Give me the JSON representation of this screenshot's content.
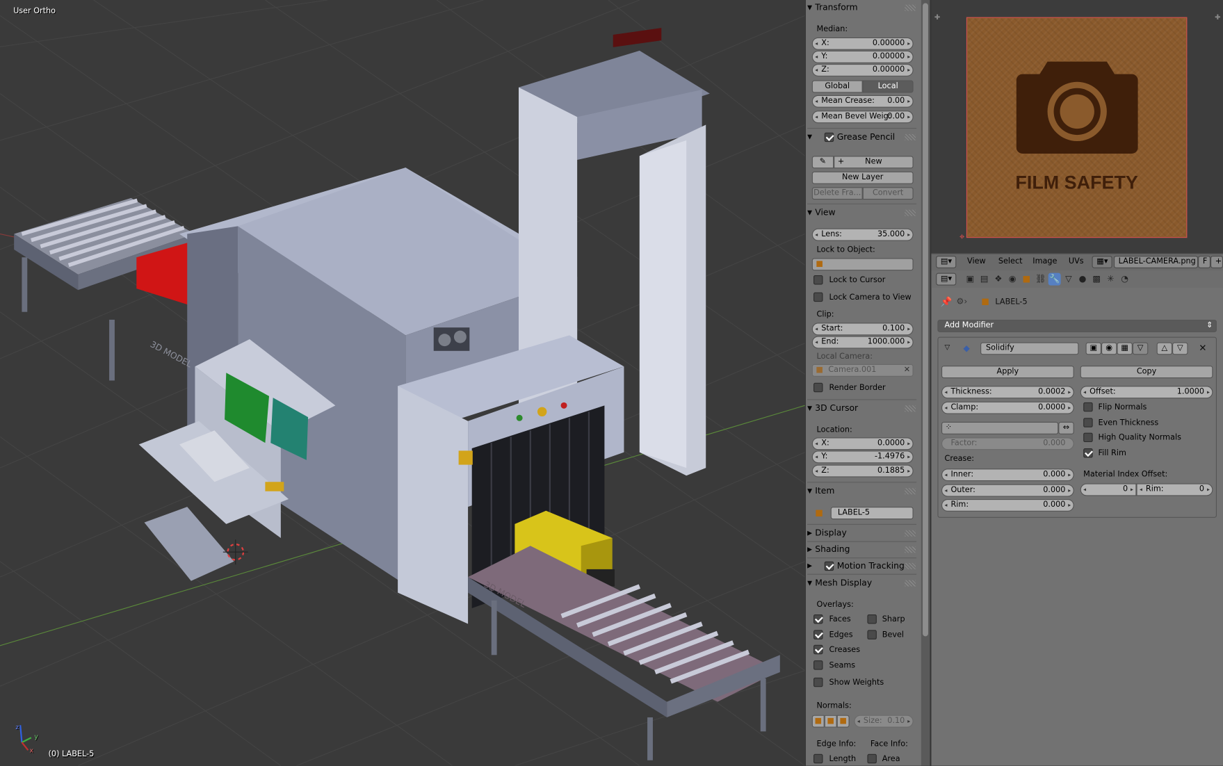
{
  "viewport": {
    "view_name": "User Ortho",
    "object_info": "(0) LABEL-5",
    "watermark": "3D MODEL",
    "axis": {
      "x": "x",
      "y": "y",
      "z": "z"
    }
  },
  "transform": {
    "title": "Transform",
    "median_label": "Median:",
    "x": {
      "label": "X:",
      "value": "0.00000"
    },
    "y": {
      "label": "Y:",
      "value": "0.00000"
    },
    "z": {
      "label": "Z:",
      "value": "0.00000"
    },
    "global_label": "Global",
    "local_label": "Local",
    "mean_crease": {
      "label": "Mean Crease:",
      "value": "0.00"
    },
    "mean_bevel": {
      "label": "Mean Bevel Weig:",
      "value": "0.00"
    }
  },
  "grease_pencil": {
    "title": "Grease Pencil",
    "new_label": "New",
    "new_layer_label": "New Layer",
    "delete_frame_label": "Delete Fra...",
    "convert_label": "Convert"
  },
  "view": {
    "title": "View",
    "lens": {
      "label": "Lens:",
      "value": "35.000"
    },
    "lock_to_object_label": "Lock to Object:",
    "lock_to_cursor_label": "Lock to Cursor",
    "lock_camera_label": "Lock Camera to View",
    "clip_label": "Clip:",
    "clip_start": {
      "label": "Start:",
      "value": "0.100"
    },
    "clip_end": {
      "label": "End:",
      "value": "1000.000"
    },
    "local_camera_label": "Local Camera:",
    "local_camera_value": "Camera.001",
    "render_border_label": "Render Border"
  },
  "cursor": {
    "title": "3D Cursor",
    "location_label": "Location:",
    "x": {
      "label": "X:",
      "value": "0.0000"
    },
    "y": {
      "label": "Y:",
      "value": "-1.4976"
    },
    "z": {
      "label": "Z:",
      "value": "0.1885"
    }
  },
  "item": {
    "title": "Item",
    "name": "LABEL-5"
  },
  "collapsed": {
    "display": "Display",
    "shading": "Shading",
    "motion_tracking": "Motion Tracking"
  },
  "mesh_display": {
    "title": "Mesh Display",
    "overlays_label": "Overlays:",
    "faces": "Faces",
    "sharp": "Sharp",
    "edges": "Edges",
    "bevel": "Bevel",
    "creases": "Creases",
    "seams": "Seams",
    "show_weights": "Show Weights",
    "normals_label": "Normals:",
    "size": {
      "label": "Size:",
      "value": "0.10"
    },
    "edge_info_label": "Edge Info:",
    "face_info_label": "Face Info:",
    "length": "Length",
    "area": "Area"
  },
  "image_editor": {
    "label_text": "FILM SAFETY",
    "menu": [
      "View",
      "Select",
      "Image",
      "UVs"
    ],
    "image_name": "LABEL-CAMERA.png",
    "f_label": "F"
  },
  "properties": {
    "object_name": "LABEL-5",
    "add_modifier_label": "Add Modifier",
    "modifier_name": "Solidify",
    "apply_label": "Apply",
    "copy_label": "Copy",
    "thickness": {
      "label": "Thickness:",
      "value": "0.0002"
    },
    "offset": {
      "label": "Offset:",
      "value": "1.0000"
    },
    "clamp": {
      "label": "Clamp:",
      "value": "0.0000"
    },
    "flip_normals": "Flip Normals",
    "even_thickness": "Even Thickness",
    "high_quality_normals": "High Quality Normals",
    "fill_rim": "Fill Rim",
    "factor": {
      "label": "Factor:",
      "value": "0.000"
    },
    "crease_label": "Crease:",
    "inner": {
      "label": "Inner:",
      "value": "0.000"
    },
    "outer": {
      "label": "Outer:",
      "value": "0.000"
    },
    "rim": {
      "label": "Rim:",
      "value": "0.000"
    },
    "material_index_offset_label": "Material Index Offset:",
    "mat_offset_value": "0",
    "mat_rim": {
      "label": "Rim:",
      "value": "0"
    }
  }
}
